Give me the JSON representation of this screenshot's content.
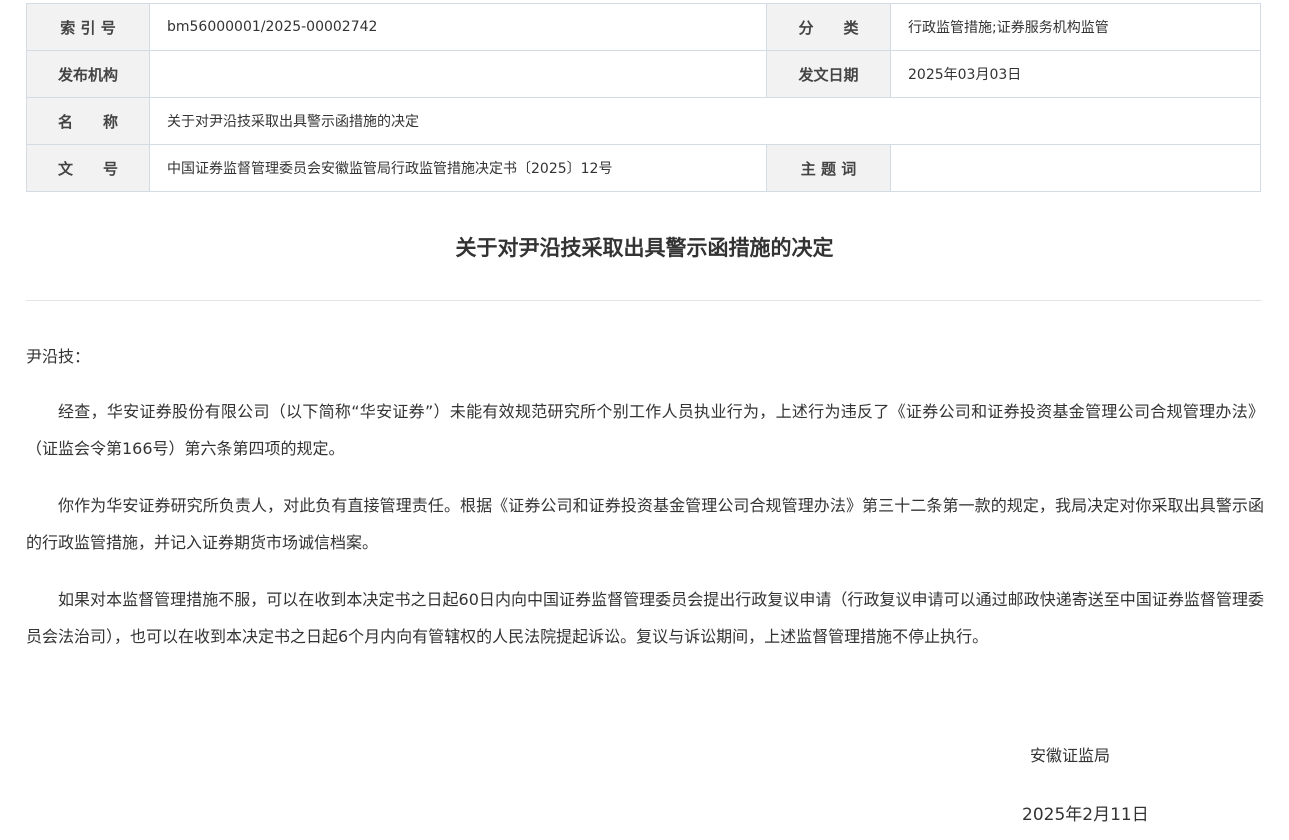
{
  "meta": {
    "index_label": "索 引 号",
    "index_value": "bm56000001/2025-00002742",
    "category_label": "分　　类",
    "category_value": "行政监管措施;证券服务机构监管",
    "publisher_label": "发布机构",
    "publisher_value": "",
    "date_label": "发文日期",
    "date_value": "2025年03月03日",
    "name_label": "名　　称",
    "name_value": "关于对尹沿技采取出具警示函措施的决定",
    "docno_label": "文　　号",
    "docno_value": "中国证券监督管理委员会安徽监管局行政监管措施决定书〔2025〕12号",
    "keywords_label": "主 题 词",
    "keywords_value": ""
  },
  "doc": {
    "title": "关于对尹沿技采取出具警示函措施的决定",
    "salutation": "尹沿技：",
    "paragraphs": [
      "经查，华安证券股份有限公司（以下简称“华安证券”）未能有效规范研究所个别工作人员执业行为，上述行为违反了《证券公司和证券投资基金管理公司合规管理办法》（证监会令第166号）第六条第四项的规定。",
      "你作为华安证券研究所负责人，对此负有直接管理责任。根据《证券公司和证券投资基金管理公司合规管理办法》第三十二条第一款的规定，我局决定对你采取出具警示函的行政监管措施，并记入证券期货市场诚信档案。",
      "如果对本监督管理措施不服，可以在收到本决定书之日起60日内向中国证券监督管理委员会提出行政复议申请（行政复议申请可以通过邮政快递寄送至中国证券监督管理委员会法治司），也可以在收到本决定书之日起6个月内向有管辖权的人民法院提起诉讼。复议与诉讼期间，上述监督管理措施不停止执行。"
    ],
    "signature": "安徽证监局",
    "date": "2025年2月11日"
  }
}
